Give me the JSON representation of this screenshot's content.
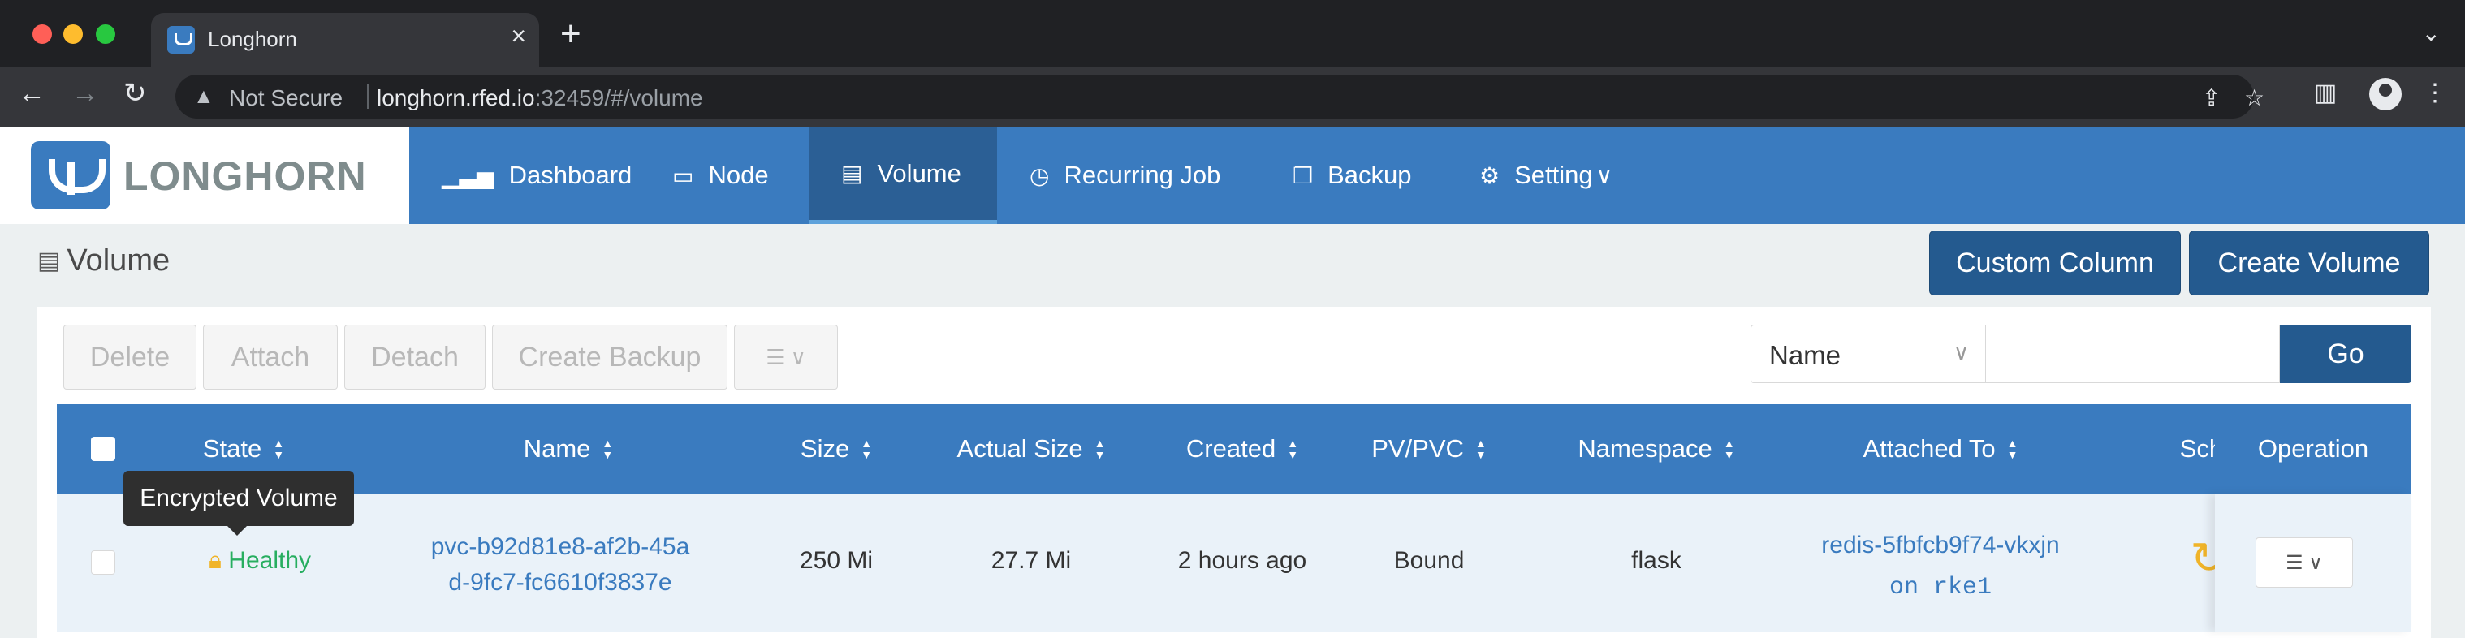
{
  "browser": {
    "tab_title": "Longhorn",
    "security_label": "Not Secure",
    "url_host": "longhorn.rfed.io",
    "url_rest": ":32459/#/volume"
  },
  "brand": {
    "name": "LONGHORN",
    "color": "#3a7bbf"
  },
  "nav": {
    "items": [
      {
        "label": "Dashboard",
        "icon": "bar-chart-icon"
      },
      {
        "label": "Node",
        "icon": "laptop-icon"
      },
      {
        "label": "Volume",
        "icon": "database-icon",
        "active": true
      },
      {
        "label": "Recurring Job",
        "icon": "clock-icon"
      },
      {
        "label": "Backup",
        "icon": "copy-icon"
      },
      {
        "label": "Setting",
        "icon": "gear-icon"
      }
    ]
  },
  "page": {
    "title": "Volume",
    "custom_column_label": "Custom Column",
    "create_volume_label": "Create Volume"
  },
  "toolbar": {
    "delete_label": "Delete",
    "attach_label": "Attach",
    "detach_label": "Detach",
    "create_backup_label": "Create Backup"
  },
  "filter": {
    "field": "Name",
    "value": "",
    "go_label": "Go"
  },
  "table": {
    "columns": [
      "State",
      "Name",
      "Size",
      "Actual Size",
      "Created",
      "PV/PVC",
      "Namespace",
      "Attached To",
      "Sche",
      "Operation"
    ],
    "rows": [
      {
        "state": "Healthy",
        "name_line1": "pvc-b92d81e8-af2b-45a",
        "name_line2": "d-9fc7-fc6610f3837e",
        "size": "250 Mi",
        "actual_size": "27.7 Mi",
        "created": "2 hours ago",
        "pv_pvc": "Bound",
        "namespace": "flask",
        "attached_to": "redis-5fbfcb9f74-vkxjn",
        "attached_node": "on rke1"
      }
    ]
  },
  "tooltip": {
    "text": "Encrypted Volume"
  },
  "colors": {
    "header": "#3a7bbf",
    "active_nav": "#2b5f95",
    "healthy": "#27ae60",
    "lock": "#f0b429"
  }
}
